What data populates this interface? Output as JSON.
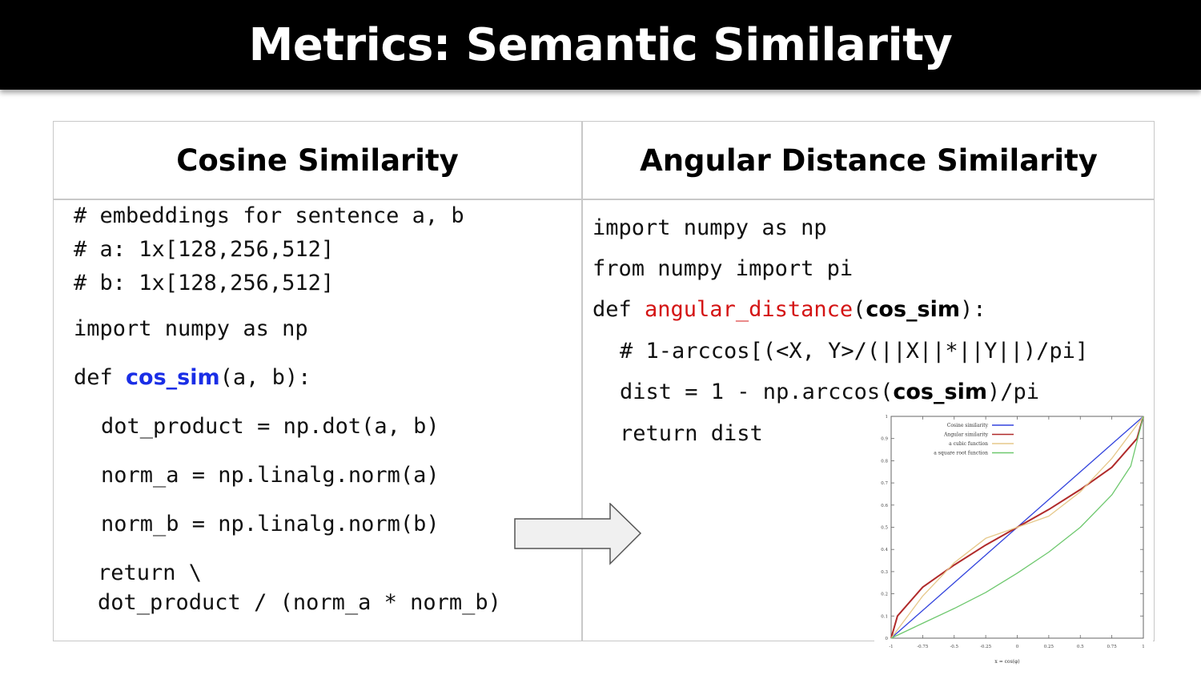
{
  "slide": {
    "title": "Metrics: Semantic Similarity"
  },
  "left_column": {
    "heading": "Cosine Similarity",
    "lines": {
      "c1": "# embeddings for sentence a, b",
      "c2": "# a: 1x[128,256,512]",
      "c3": "# b: 1x[128,256,512]",
      "imp": "import numpy as np",
      "def_kw": "def ",
      "def_name": "cos_sim",
      "def_args": "(a, b):",
      "dot": "dot_product = np.dot(a, b)",
      "norm_a": "norm_a = np.linalg.norm(a)",
      "norm_b": "norm_b = np.linalg.norm(b)",
      "ret1": "return \\",
      "ret2": "dot_product / (norm_a * norm_b)"
    }
  },
  "right_column": {
    "heading": "Angular Distance Similarity",
    "lines": {
      "imp": "import numpy as np",
      "from": "from numpy import pi",
      "def_kw": "def ",
      "def_name": "angular_distance",
      "def_open": "(",
      "def_arg": "cos_sim",
      "def_close": "):",
      "comment": "# 1-arccos[(<X, Y>/(||X||*||Y||)/pi]",
      "dist_pre": "dist = 1 - np.arccos(",
      "dist_arg": "cos_sim",
      "dist_post": ")/pi",
      "ret": "return dist"
    }
  },
  "chart_data": {
    "type": "line",
    "xlabel": "x = cos(φ)",
    "ylabel": "",
    "xlim": [
      -1,
      1
    ],
    "ylim": [
      0,
      1
    ],
    "x_ticks": [
      "-1",
      "-0.75",
      "-0.5",
      "-0.25",
      "0",
      "0.25",
      "0.5",
      "0.75",
      "1"
    ],
    "y_ticks": [
      "0",
      "0.1",
      "0.2",
      "0.3",
      "0.4",
      "0.5",
      "0.6",
      "0.7",
      "0.8",
      "0.9",
      "1"
    ],
    "legend_position": "top-left",
    "series": [
      {
        "name": "Cosine similarity",
        "color": "#3344dd",
        "x": [
          -1,
          -0.5,
          0,
          0.5,
          1
        ],
        "y": [
          0,
          0.25,
          0.5,
          0.75,
          1
        ]
      },
      {
        "name": "Angular similarity",
        "color": "#b02a2a",
        "x": [
          -1,
          -0.95,
          -0.75,
          -0.5,
          -0.25,
          0,
          0.25,
          0.5,
          0.75,
          0.95,
          1
        ],
        "y": [
          0,
          0.1,
          0.23,
          0.33,
          0.42,
          0.5,
          0.58,
          0.67,
          0.77,
          0.9,
          1
        ]
      },
      {
        "name": "a cubic function",
        "color": "#e6c88a",
        "x": [
          -1,
          -0.75,
          -0.5,
          -0.25,
          0,
          0.25,
          0.5,
          0.75,
          1
        ],
        "y": [
          0,
          0.19,
          0.34,
          0.45,
          0.5,
          0.55,
          0.66,
          0.81,
          1
        ]
      },
      {
        "name": "a square root function",
        "color": "#6ec86e",
        "x": [
          -1,
          -0.75,
          -0.5,
          -0.25,
          0,
          0.25,
          0.5,
          0.75,
          0.9,
          1
        ],
        "y": [
          0,
          0.067,
          0.134,
          0.206,
          0.293,
          0.388,
          0.5,
          0.646,
          0.776,
          1
        ]
      }
    ]
  }
}
